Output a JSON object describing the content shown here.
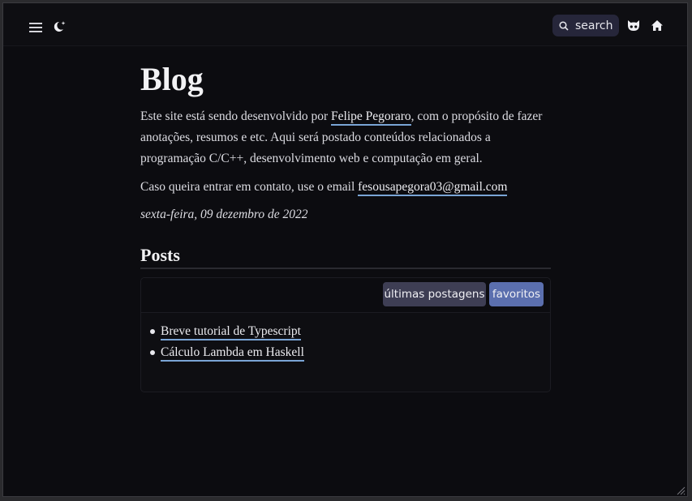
{
  "topbar": {
    "search_label": "search",
    "icons": [
      "menu-icon",
      "moon-icon",
      "search-icon",
      "github-icon",
      "home-icon"
    ]
  },
  "page": {
    "title": "Blog",
    "intro_before": "Este site está sendo desenvolvido por ",
    "author_link": "Felipe Pegoraro",
    "intro_after": ", com o propósito de fazer anotações, resumos e etc. Aqui será postado conteúdos relacionados a programação C/C++, desenvolvimento web e computação em geral.",
    "contact_text": "Caso queira entrar em contato, use o email ",
    "email_link": "fesousapegora03@gmail.com",
    "date": "sexta-feira, 09 dezembro de 2022"
  },
  "posts": {
    "heading": "Posts",
    "tabs": [
      {
        "label": "últimas postagens",
        "active": false
      },
      {
        "label": "favoritos",
        "active": true
      }
    ],
    "items": [
      {
        "title": "Breve tutorial de Typescript"
      },
      {
        "title": "Cálculo Lambda em Haskell"
      }
    ]
  },
  "colors": {
    "background": "#0c0c10",
    "accent_link_underline": "#7aa5d6",
    "tab_active": "#5b6fae",
    "tab_inactive": "#3e3e54",
    "search_bg": "#26263a"
  }
}
